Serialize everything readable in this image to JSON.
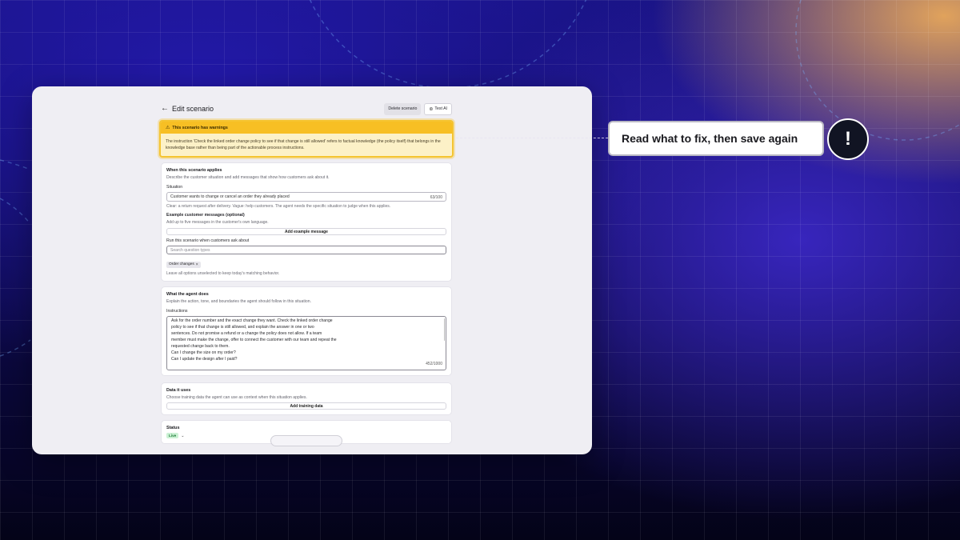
{
  "page": {
    "title": "Edit scenario",
    "actions": {
      "delete_label": "Delete scenario",
      "test_label": "Test AI"
    }
  },
  "warning": {
    "heading": "This scenario has warnings",
    "message": "The instruction 'Check the linked order change policy to see if that change is still allowed' refers to factual knowledge (the policy itself) that belongs in the knowledge base rather than being part of the actionable process instructions."
  },
  "applies": {
    "title": "When this scenario applies",
    "description": "Describe the customer situation and add messages that show how customers ask about it.",
    "situation_label": "Situation",
    "situation_value": "Customer wants to change or cancel an order they already placed",
    "situation_counter": "63/100",
    "situation_hint": "Clear: a return request after delivery. Vague: help customers. The agent needs the specific situation to judge when this applies.",
    "examples_label": "Example customer messages (optional)",
    "examples_hint": "Add up to five messages in the customer's own language.",
    "add_example_label": "Add example message",
    "run_label": "Run this scenario when customers ask about",
    "search_placeholder": "Search question types",
    "chips": [
      "Order changes"
    ],
    "run_hint": "Leave all options unselected to keep today's matching behavior."
  },
  "agent": {
    "title": "What the agent does",
    "description": "Explain the action, tone, and boundaries the agent should follow in this situation.",
    "instructions_label": "Instructions",
    "instructions_lines": [
      "Ask for the order number and the exact change they want. Check the linked order change",
      "policy to see if that change is still allowed, and explain the answer in one or two",
      "sentences. Do not promise a refund or a change the policy does not allow. If a team",
      "member must make the change, offer to connect the customer with our team and repeat the",
      "requested change back to them.",
      "Can I change the size on my order?",
      "Can I update the design after I paid?"
    ],
    "instructions_counter": "452/1000"
  },
  "data_uses": {
    "title": "Data it uses",
    "description": "Choose training data the agent can use as context when this situation applies.",
    "add_label": "Add training data"
  },
  "status": {
    "title": "Status",
    "value": "Live"
  },
  "callout": {
    "text": "Read what to fix, then save again",
    "icon": "!"
  },
  "colors": {
    "warning_bg": "#fcf1c7",
    "warning_head": "#f7bf24",
    "live_badge": "#cbf1d4",
    "live_text": "#1e7a38"
  },
  "icons": {
    "back": "arrow-left-icon",
    "test": "sparkle-icon",
    "warning": "warning-triangle-icon",
    "chip_remove": "close-icon",
    "status_toggle": "chevron-down-icon"
  }
}
